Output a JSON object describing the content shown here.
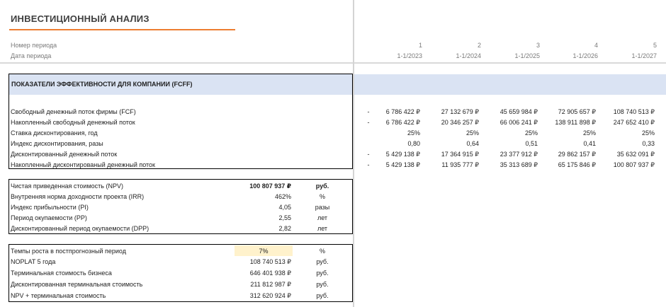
{
  "header": {
    "title": "ИНВЕСТИЦИОННЫЙ АНАЛИЗ",
    "period_number_label": "Номер периода",
    "period_date_label": "Дата периода",
    "periods": [
      {
        "number": "1",
        "date": "1-1/2023"
      },
      {
        "number": "2",
        "date": "1-1/2024"
      },
      {
        "number": "3",
        "date": "1-1/2025"
      },
      {
        "number": "4",
        "date": "1-1/2026"
      },
      {
        "number": "5",
        "date": "1-1/2027"
      }
    ]
  },
  "fcff": {
    "section_title": "ПОКАЗАТЕЛИ ЭФФЕКТИВНОСТИ ДЛЯ КОМПАНИИ (FCFF)",
    "rows": [
      {
        "label": "Свободный денежный поток фирмы (FCF)",
        "dash": "-",
        "values": [
          "6 786 422 ₽",
          "27 132 679 ₽",
          "45 659 984 ₽",
          "72 905 657 ₽",
          "108 740 513 ₽"
        ]
      },
      {
        "label": "Накопленный свободный денежный поток",
        "dash": "-",
        "values": [
          "6 786 422 ₽",
          "20 346 257 ₽",
          "66 006 241 ₽",
          "138 911 898 ₽",
          "247 652 410 ₽"
        ]
      },
      {
        "label": "Ставка дисконтирования, год",
        "dash": "",
        "values": [
          "25%",
          "25%",
          "25%",
          "25%",
          "25%"
        ]
      },
      {
        "label": "Индекс дисконтирования, разы",
        "dash": "",
        "values": [
          "0,80",
          "0,64",
          "0,51",
          "0,41",
          "0,33"
        ]
      },
      {
        "label": "Дисконтированный денежный поток",
        "dash": "-",
        "values": [
          "5 429 138 ₽",
          "17 364 915 ₽",
          "23 377 912 ₽",
          "29 862 157 ₽",
          "35 632 091 ₽"
        ]
      },
      {
        "label": "Накопленный дисконтированый денежный поток",
        "dash": "-",
        "values": [
          "5 429 138 ₽",
          "11 935 777 ₽",
          "35 313 689 ₽",
          "65 175 846 ₽",
          "100 807 937 ₽"
        ]
      }
    ]
  },
  "kpi": {
    "rows": [
      {
        "label": "Чистая приведенная стоимость (NPV)",
        "value": "100 807 937 ₽",
        "unit": "руб."
      },
      {
        "label": "Внутренняя норма доходности проекта (IRR)",
        "value": "462%",
        "unit": "%"
      },
      {
        "label": "Индекс прибыльности (PI)",
        "value": "4,05",
        "unit": "разы"
      },
      {
        "label": "Период окупаемости (PP)",
        "value": "2,55",
        "unit": "лет"
      },
      {
        "label": "Дисконтированный период окупаемости (DPP)",
        "value": "2,82",
        "unit": "лет"
      }
    ]
  },
  "terminal": {
    "rows": [
      {
        "label": "Темпы роста в постпрогнозный период",
        "value": "7%",
        "unit": "%"
      },
      {
        "label": "NOPLAT 5 года",
        "value": "108 740 513 ₽",
        "unit": "руб."
      },
      {
        "label": "Терминальная стоимость бизнеса",
        "value": "646 401 938 ₽",
        "unit": "руб."
      },
      {
        "label": "Дисконтированная терминальная стоимость",
        "value": "211 812 987 ₽",
        "unit": "руб."
      },
      {
        "label": "NPV + терминальная стоимость",
        "value": "312 620 924 ₽",
        "unit": "руб."
      }
    ]
  },
  "colors": {
    "accent_underline": "#ed7d31",
    "section_band": "#dae3f3",
    "input_highlight": "#fff2cc"
  }
}
